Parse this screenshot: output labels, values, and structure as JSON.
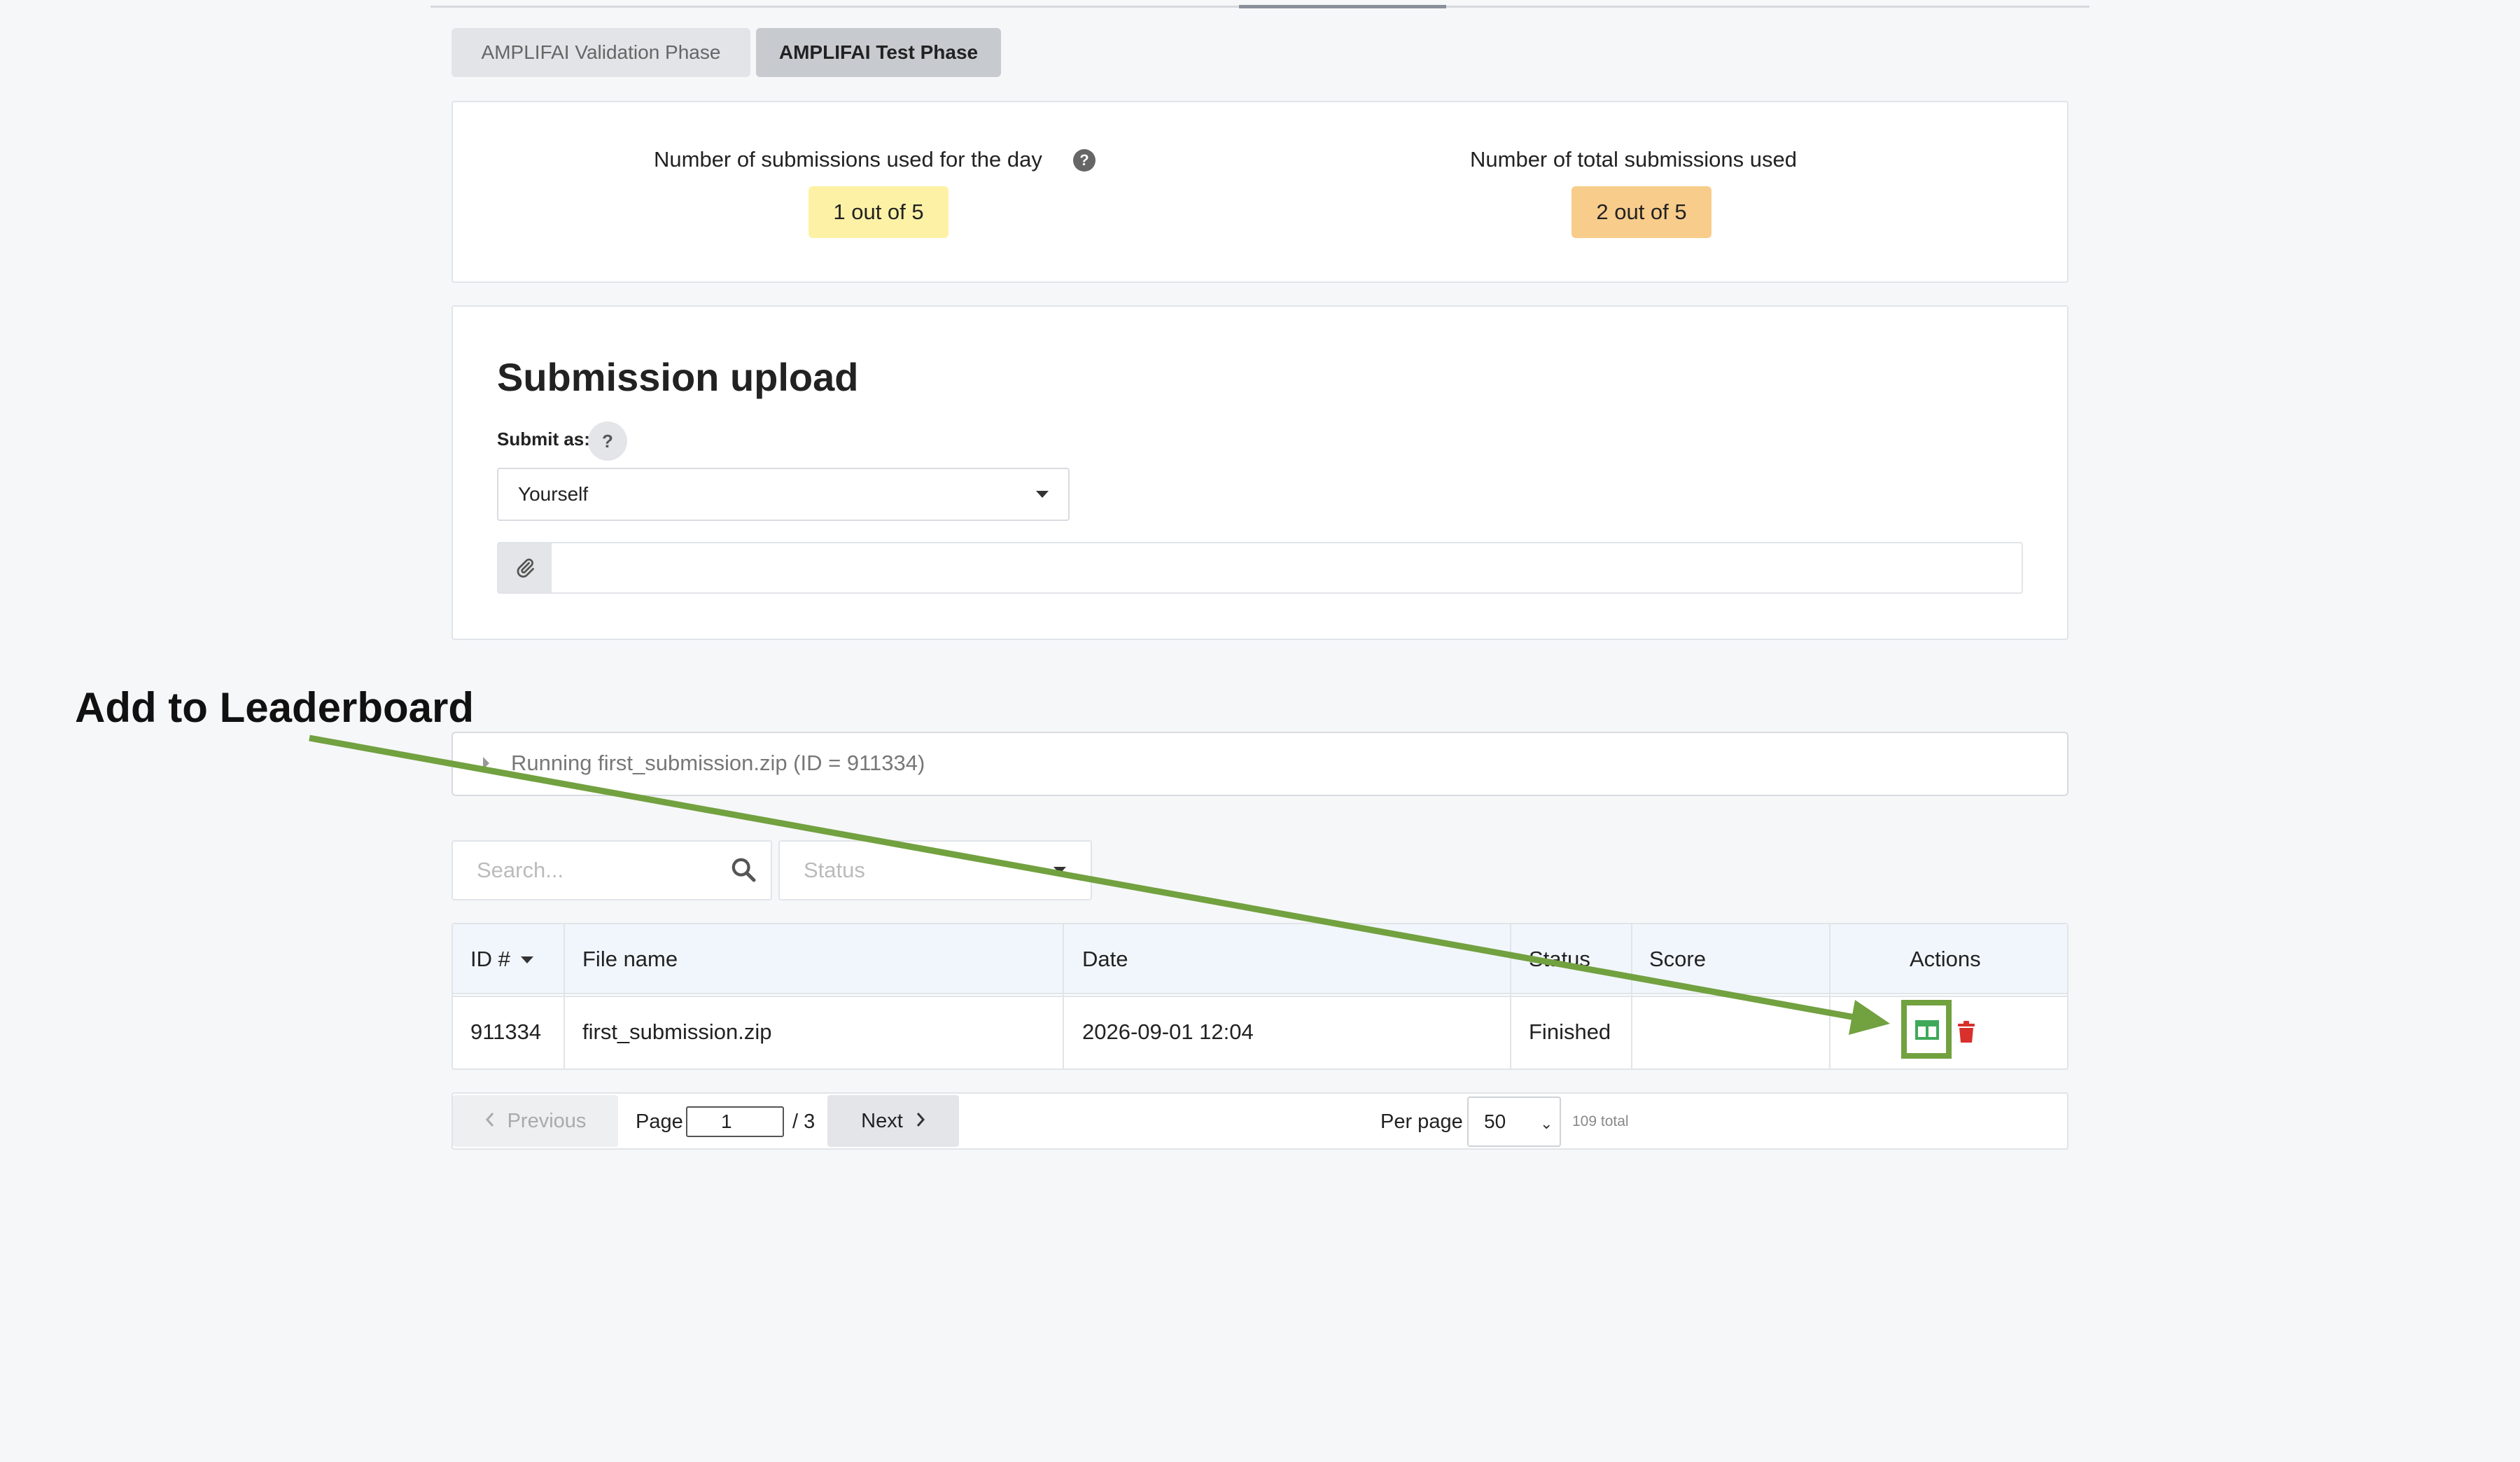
{
  "tabs": [
    {
      "label": "AMPLIFAI Validation Phase"
    },
    {
      "label": "AMPLIFAI Test Phase"
    }
  ],
  "counts": {
    "daily_label": "Number of submissions used for the day",
    "daily_value": "1 out of 5",
    "total_label": "Number of total submissions used",
    "total_value": "2 out of 5"
  },
  "upload": {
    "title": "Submission upload",
    "submit_as_label": "Submit as:",
    "help_glyph": "?",
    "submit_as_value": "Yourself"
  },
  "running": {
    "text": "Running first_submission.zip (ID = 911334)"
  },
  "filters": {
    "search_placeholder": "Search...",
    "status_placeholder": "Status"
  },
  "table": {
    "headers": {
      "id": "ID #",
      "file_name": "File name",
      "date": "Date",
      "status": "Status",
      "score": "Score",
      "actions": "Actions"
    },
    "rows": [
      {
        "id": "911334",
        "file_name": "first_submission.zip",
        "date": "2026-09-01 12:04",
        "status": "Finished",
        "score": ""
      }
    ]
  },
  "pagination": {
    "previous_label": "Previous",
    "page_label": "Page",
    "page_value": "1",
    "page_total": "/ 3",
    "next_label": "Next",
    "per_page_label": "Per page",
    "per_page_value": "50",
    "total": "109 total"
  },
  "annotation": {
    "label": "Add to Leaderboard",
    "color": "#72a140"
  },
  "colors": {
    "daily_badge": "#fdf1a6",
    "total_badge": "#f8cc8b",
    "view_icon": "#3fa95a",
    "delete_icon": "#d9302c"
  }
}
